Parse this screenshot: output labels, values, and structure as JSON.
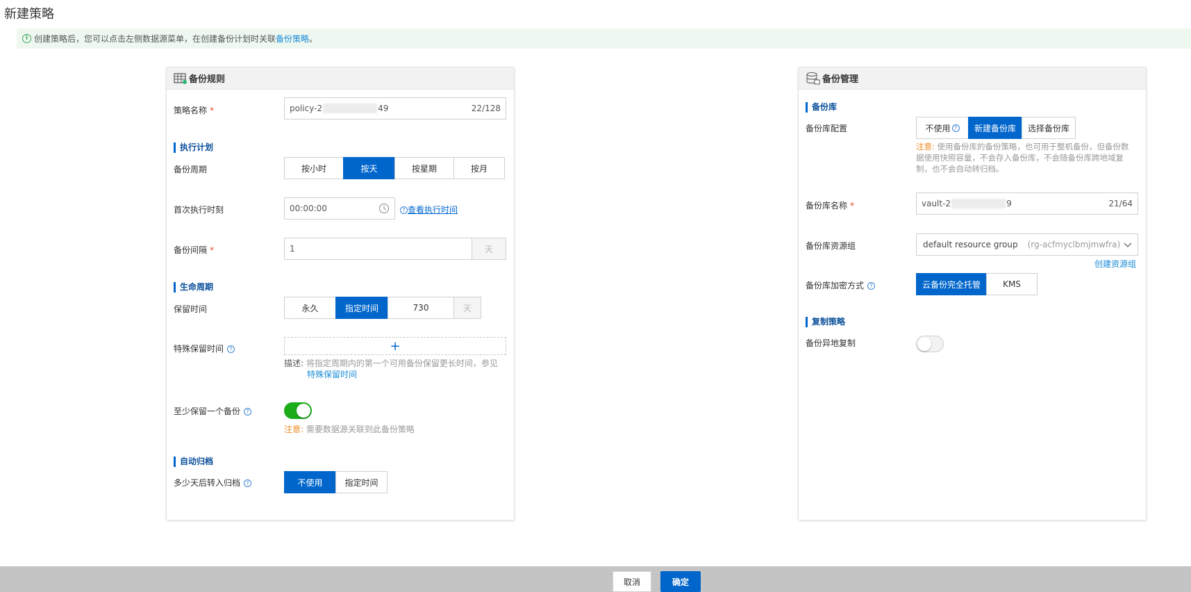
{
  "page": {
    "title": "新建策略"
  },
  "notice": {
    "text": "创建策略后，您可以点击左侧数据源菜单，在创建备份计划时关联",
    "link": "备份策略",
    "end": "。"
  },
  "left": {
    "title": "备份规则",
    "policy_name": {
      "label": "策略名称",
      "prefix": "policy-2",
      "suffix": "49",
      "count": "22/128"
    },
    "schedule_section": "执行计划",
    "cycle": {
      "label": "备份周期",
      "options": [
        "按小时",
        "按天",
        "按星期",
        "按月"
      ],
      "selected": "按天"
    },
    "first_time": {
      "label": "首次执行时刻",
      "value": "00:00:00",
      "link": "查看执行时间"
    },
    "interval": {
      "label": "备份间隔",
      "value": "1",
      "unit": "天"
    },
    "lifecycle_section": "生命周期",
    "retention": {
      "label": "保留时间",
      "options": [
        "永久",
        "指定时间"
      ],
      "selected": "指定时间",
      "value": "730",
      "unit": "天"
    },
    "special": {
      "label": "特殊保留时间",
      "add": "+",
      "desc_prefix": "描述:",
      "desc": "将指定周期内的第一个可用备份保留更长时间，参见",
      "desc_link": "特殊保留时间"
    },
    "keep_one": {
      "label": "至少保留一个备份",
      "on": true,
      "note_prefix": "注意:",
      "note": "需要数据源关联到此备份策略"
    },
    "archive_section": "自动归档",
    "archive": {
      "label": "多少天后转入归档",
      "options": [
        "不使用",
        "指定时间"
      ],
      "selected": "不使用"
    }
  },
  "right": {
    "title": "备份管理",
    "vault_section": "备份库",
    "vault_config": {
      "label": "备份库配置",
      "options": [
        "不使用",
        "新建备份库",
        "选择备份库"
      ],
      "selected": "新建备份库",
      "note_prefix": "注意:",
      "note": "使用备份库的备份策略，也可用于整机备份，但备份数据使用快照容量，不会存入备份库，不会随备份库跨地域复制，也不会自动转归档。"
    },
    "vault_name": {
      "label": "备份库名称",
      "prefix": "vault-2",
      "suffix": "9",
      "count": "21/64"
    },
    "resource_group": {
      "label": "备份库资源组",
      "value": "default resource group",
      "id": "(rg-acfmyclbmjmwfra)",
      "link": "创建资源组"
    },
    "encryption": {
      "label": "备份库加密方式",
      "options": [
        "云备份完全托管",
        "KMS"
      ],
      "selected": "云备份完全托管"
    },
    "replication_section": "复制策略",
    "replication": {
      "label": "备份异地复制",
      "on": false
    }
  },
  "footer": {
    "cancel": "取消",
    "ok": "确定"
  },
  "colors": {
    "primary": "#0066cc",
    "toggle_on": "#1aad19",
    "warning": "#f08a24",
    "notice_bg": "#eef8f0"
  }
}
